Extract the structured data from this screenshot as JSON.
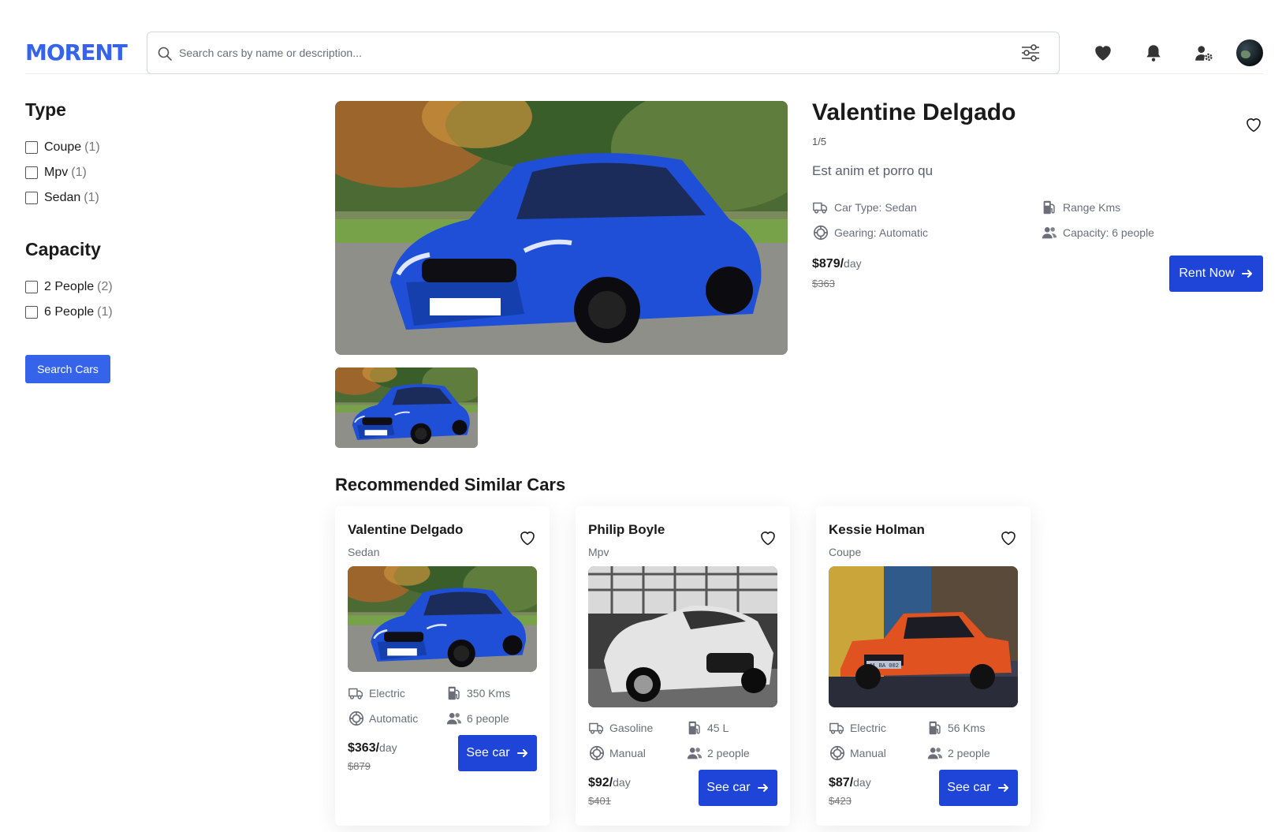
{
  "header": {
    "logo": "MORENT",
    "search_placeholder": "Search cars by name or description...",
    "icons": [
      "search-icon",
      "filter-sliders-icon",
      "heart-icon",
      "bell-icon",
      "user-settings-icon",
      "avatar"
    ]
  },
  "sidebar": {
    "type_title": "Type",
    "type_filters": [
      {
        "label": "Coupe",
        "count": "(1)"
      },
      {
        "label": "Mpv",
        "count": "(1)"
      },
      {
        "label": "Sedan",
        "count": "(1)"
      }
    ],
    "capacity_title": "Capacity",
    "capacity_filters": [
      {
        "label": "2 People",
        "count": "(2)"
      },
      {
        "label": "6 People",
        "count": "(1)"
      }
    ],
    "search_button": "Search Cars"
  },
  "detail": {
    "title": "Valentine Delgado",
    "image_counter": "1/5",
    "description": "Est anim et porro qu",
    "specs": {
      "car_type": "Car Type: Sedan",
      "range": "Range Kms",
      "gearing": "Gearing: Automatic",
      "capacity": "Capacity: 6 people"
    },
    "price": "$879/",
    "per": "day",
    "old_price": "$363",
    "rent_button": "Rent Now"
  },
  "recommended": {
    "title": "Recommended Similar Cars",
    "cards": [
      {
        "name": "Valentine Delgado",
        "type": "Sedan",
        "fuel": "Electric",
        "range": "350 Kms",
        "gear": "Automatic",
        "capacity": "6 people",
        "price": "$363/",
        "per": "day",
        "old_price": "$879",
        "button": "See car"
      },
      {
        "name": "Philip Boyle",
        "type": "Mpv",
        "fuel": "Gasoline",
        "range": "45 L",
        "gear": "Manual",
        "capacity": "2 people",
        "price": "$92/",
        "per": "day",
        "old_price": "$401",
        "button": "See car"
      },
      {
        "name": "Kessie Holman",
        "type": "Coupe",
        "fuel": "Electric",
        "range": "56 Kms",
        "gear": "Manual",
        "capacity": "2 people",
        "price": "$87/",
        "per": "day",
        "old_price": "$423",
        "button": "See car"
      }
    ]
  },
  "colors": {
    "brand": "#3563e9",
    "button": "#1f45d8",
    "muted_text": "#6b6e78"
  },
  "photo_plate_text": "41 BA 002"
}
